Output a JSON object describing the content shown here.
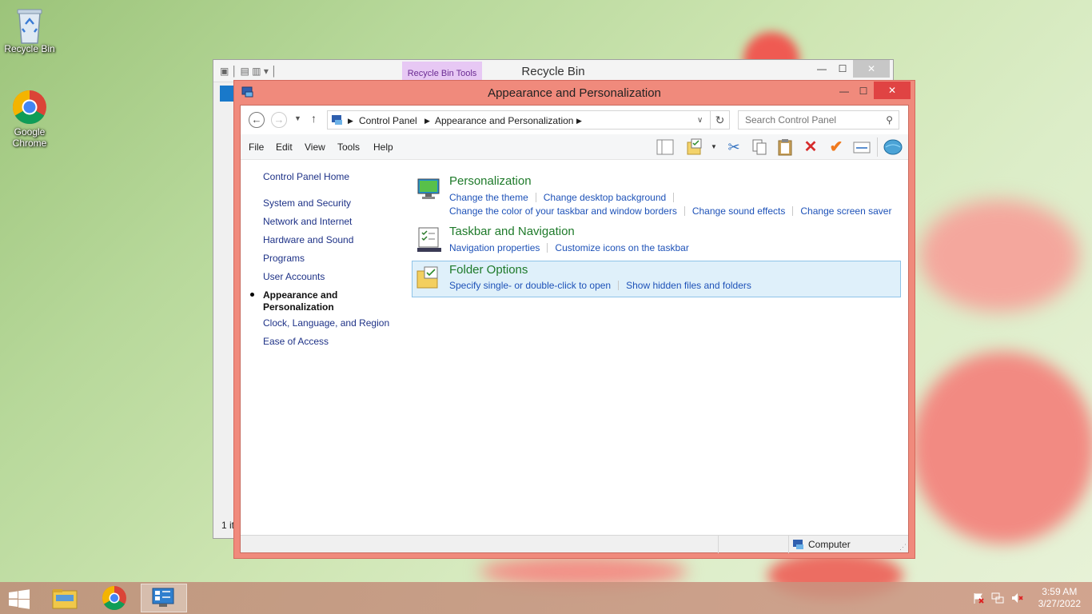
{
  "desktop": {
    "icons": [
      {
        "label": "Recycle Bin"
      },
      {
        "label": "Google Chrome"
      }
    ]
  },
  "recycle_window": {
    "title": "Recycle Bin",
    "ribbon_context_tab": "Recycle Bin Tools",
    "status_text": "1 it"
  },
  "window": {
    "title": "Appearance and Personalization",
    "breadcrumb": [
      "Control Panel",
      "Appearance and Personalization"
    ],
    "search_placeholder": "Search Control Panel",
    "menu": [
      "File",
      "Edit",
      "View",
      "Tools",
      "Help"
    ],
    "sidebar": {
      "home": "Control Panel Home",
      "items": [
        "System and Security",
        "Network and Internet",
        "Hardware and Sound",
        "Programs",
        "User Accounts",
        "Appearance and Personalization",
        "Clock, Language, and Region",
        "Ease of Access"
      ],
      "current_index": 5
    },
    "categories": [
      {
        "title": "Personalization",
        "links": [
          "Change the theme",
          "Change desktop background",
          "Change the color of your taskbar and window borders",
          "Change sound effects",
          "Change screen saver"
        ]
      },
      {
        "title": "Taskbar and Navigation",
        "links": [
          "Navigation properties",
          "Customize icons on the taskbar"
        ]
      },
      {
        "title": "Folder Options",
        "links": [
          "Specify single- or double-click to open",
          "Show hidden files and folders"
        ],
        "selected": true
      }
    ],
    "status_location": "Computer"
  },
  "taskbar": {
    "time": "3:59 AM",
    "date": "3/27/2022"
  },
  "colors": {
    "window_accent": "#f08a7c",
    "heading_green": "#1e7a2a",
    "link_blue": "#1e52b8",
    "selected_bg": "#dff0fa"
  }
}
